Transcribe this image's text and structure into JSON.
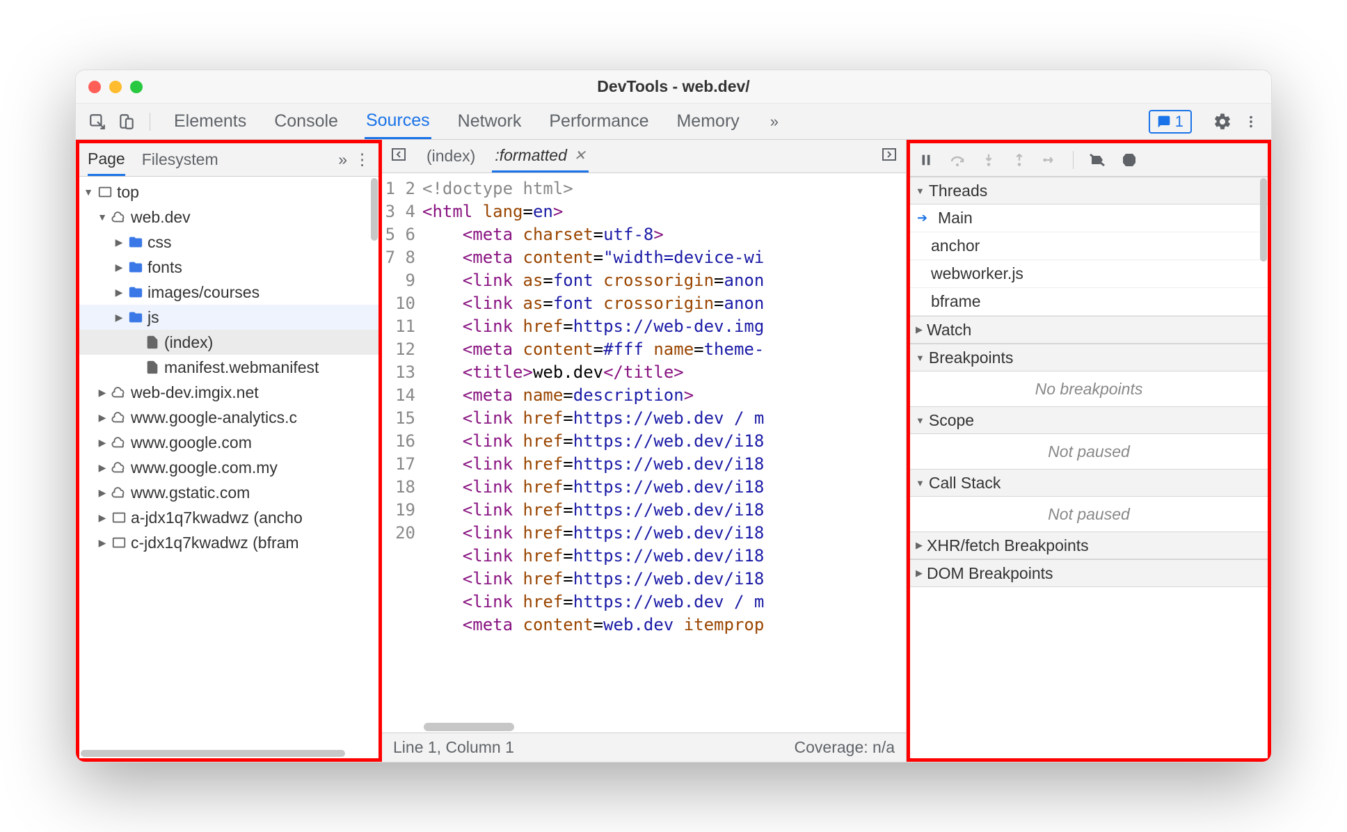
{
  "window_title": "DevTools - web.dev/",
  "main_tabs": {
    "elements": "Elements",
    "console": "Console",
    "sources": "Sources",
    "network": "Network",
    "performance": "Performance",
    "memory": "Memory"
  },
  "messages_count": "1",
  "navigator": {
    "tabs": {
      "page": "Page",
      "filesystem": "Filesystem"
    },
    "tree": {
      "top": "top",
      "webdev": "web.dev",
      "css": "css",
      "fonts": "fonts",
      "images": "images/courses",
      "js": "js",
      "index": "(index)",
      "manifest": "manifest.webmanifest",
      "imgix": "web-dev.imgix.net",
      "ga": "www.google-analytics.c",
      "google": "www.google.com",
      "googlemy": "www.google.com.my",
      "gstatic": "www.gstatic.com",
      "anchor": "a-jdx1q7kwadwz (ancho",
      "bframe": "c-jdx1q7kwadwz (bfram"
    }
  },
  "editor": {
    "tabs": {
      "index": "(index)",
      "formatted": ":formatted"
    },
    "gutter": [
      "1",
      "2",
      "3",
      "4",
      "5",
      "6",
      "7",
      "8",
      "9",
      "10",
      "11",
      "12",
      "13",
      "14",
      "15",
      "16",
      "17",
      "18",
      "19",
      "20"
    ],
    "l1": {
      "a": "<!doctype html>"
    },
    "l2": {
      "a": "<",
      "b": "html",
      "c": " lang",
      "d": "=",
      "e": "en",
      "f": ">"
    },
    "l3": {
      "a": "    <",
      "b": "meta",
      "c": " charset",
      "d": "=",
      "e": "utf-8",
      "f": ">"
    },
    "l4": {
      "a": "    <",
      "b": "meta",
      "c": " content",
      "d": "=",
      "e": "\"width=device-wi"
    },
    "l5": {
      "a": "    <",
      "b": "link",
      "c": " as",
      "d": "=",
      "e": "font",
      "f": " crossorigin",
      "g": "=",
      "h": "anon"
    },
    "l6": {
      "a": "    <",
      "b": "link",
      "c": " as",
      "d": "=",
      "e": "font",
      "f": " crossorigin",
      "g": "=",
      "h": "anon"
    },
    "l7": {
      "a": "    <",
      "b": "link",
      "c": " href",
      "d": "=",
      "e": "https://web-dev.img"
    },
    "l8": {
      "a": "    <",
      "b": "meta",
      "c": " content",
      "d": "=",
      "e": "#fff",
      "f": " name",
      "g": "=",
      "h": "theme-"
    },
    "l9": {
      "a": "    <",
      "b": "title",
      "c": ">",
      "d": "web.dev",
      "e": "</",
      "f": "title",
      "g": ">"
    },
    "l10": {
      "a": "    <",
      "b": "meta",
      "c": " name",
      "d": "=",
      "e": "description",
      "f": ">"
    },
    "l11": {
      "a": "    <",
      "b": "link",
      "c": " href",
      "d": "=",
      "e": "https://web.dev / m"
    },
    "l12": {
      "a": "    <",
      "b": "link",
      "c": " href",
      "d": "=",
      "e": "https://web.dev/i18"
    },
    "l13": {
      "a": "    <",
      "b": "link",
      "c": " href",
      "d": "=",
      "e": "https://web.dev/i18"
    },
    "l14": {
      "a": "    <",
      "b": "link",
      "c": " href",
      "d": "=",
      "e": "https://web.dev/i18"
    },
    "l15": {
      "a": "    <",
      "b": "link",
      "c": " href",
      "d": "=",
      "e": "https://web.dev/i18"
    },
    "l16": {
      "a": "    <",
      "b": "link",
      "c": " href",
      "d": "=",
      "e": "https://web.dev/i18"
    },
    "l17": {
      "a": "    <",
      "b": "link",
      "c": " href",
      "d": "=",
      "e": "https://web.dev/i18"
    },
    "l18": {
      "a": "    <",
      "b": "link",
      "c": " href",
      "d": "=",
      "e": "https://web.dev/i18"
    },
    "l19": {
      "a": "    <",
      "b": "link",
      "c": " href",
      "d": "=",
      "e": "https://web.dev / m"
    },
    "l20": {
      "a": "    <",
      "b": "meta",
      "c": " content",
      "d": "=",
      "e": "web.dev",
      "f": " itemprop"
    },
    "status_line": "Line 1, Column 1",
    "coverage": "Coverage: n/a"
  },
  "debugger": {
    "sections": {
      "threads": "Threads",
      "watch": "Watch",
      "breakpoints": "Breakpoints",
      "scope": "Scope",
      "callstack": "Call Stack",
      "xhr": "XHR/fetch Breakpoints",
      "dom": "DOM Breakpoints"
    },
    "threads": {
      "main": "Main",
      "anchor": "anchor",
      "webworker": "webworker.js",
      "bframe": "bframe"
    },
    "no_breakpoints": "No breakpoints",
    "not_paused": "Not paused"
  }
}
